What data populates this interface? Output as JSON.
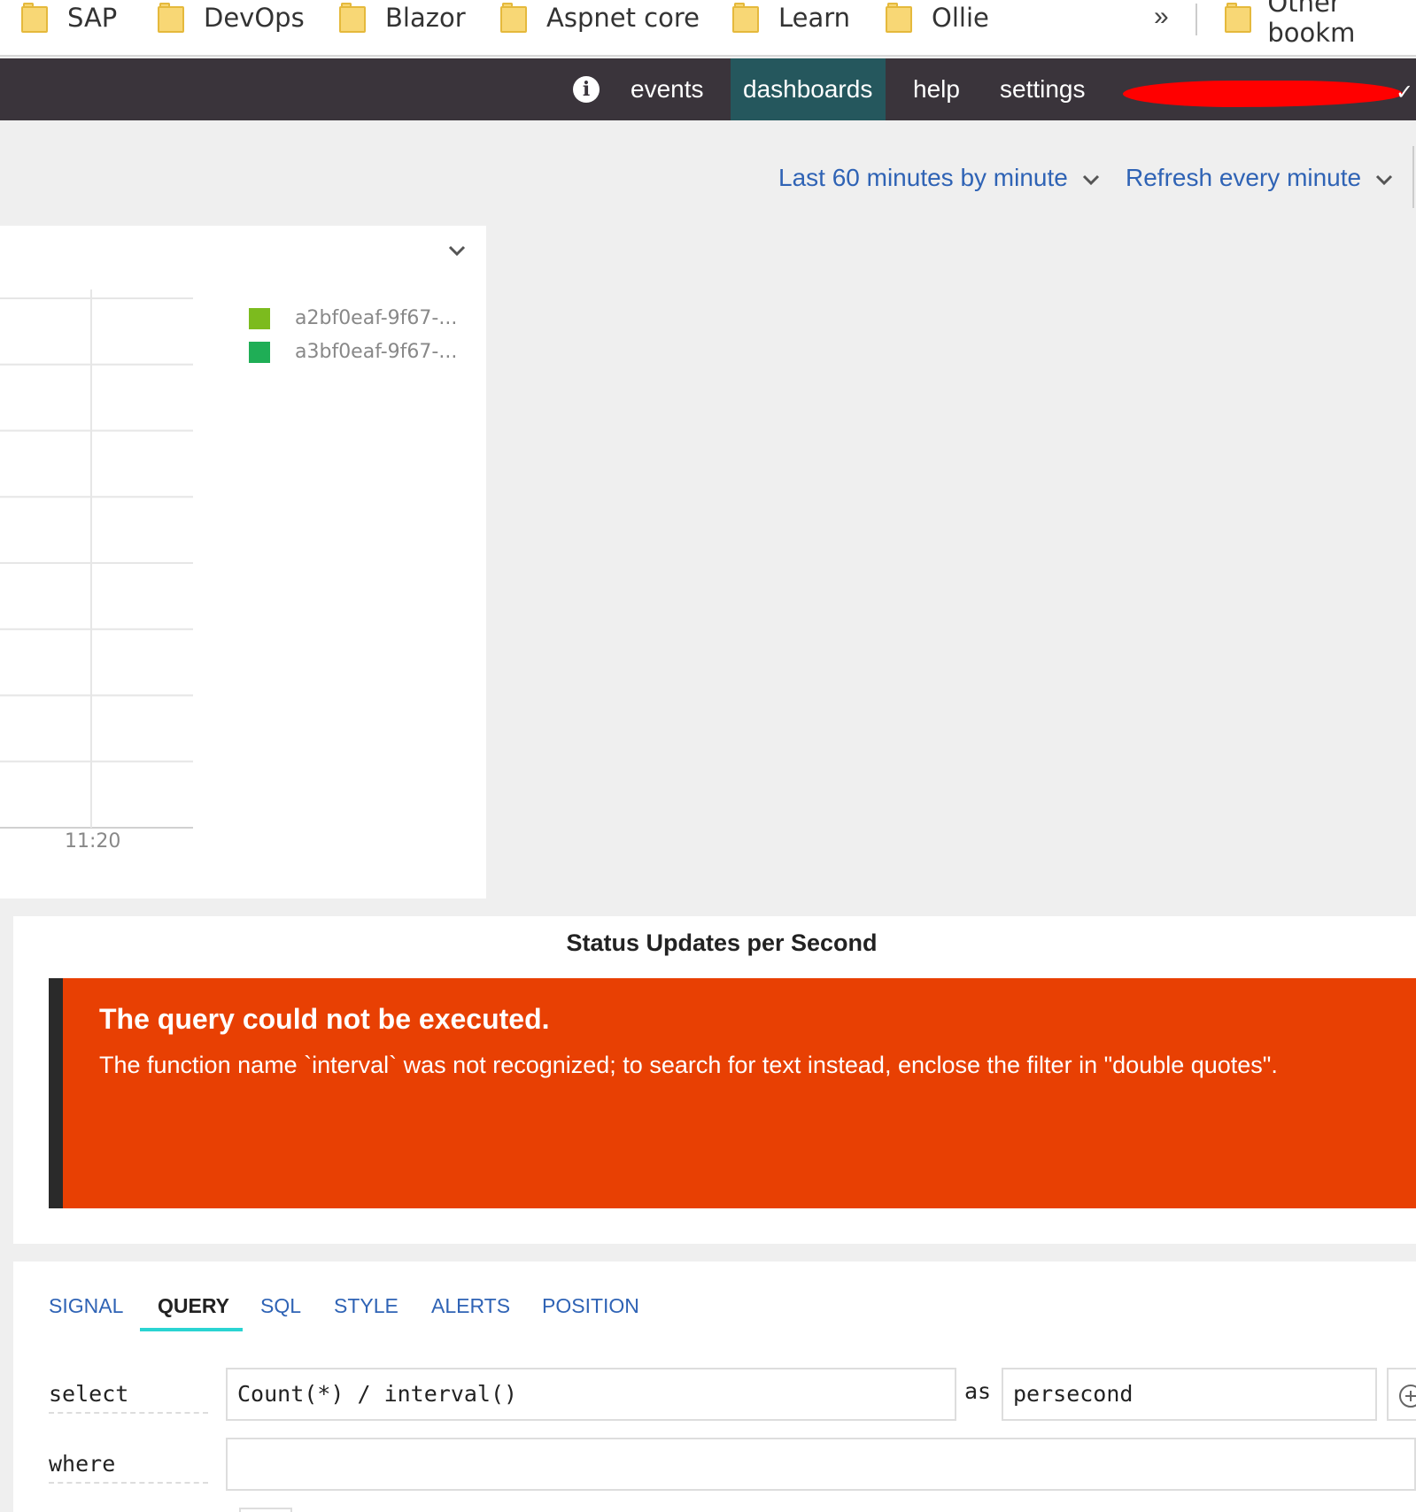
{
  "bookmarks": {
    "items": [
      {
        "label": "SAP"
      },
      {
        "label": "DevOps"
      },
      {
        "label": "Blazor"
      },
      {
        "label": "Aspnet core"
      },
      {
        "label": "Learn"
      },
      {
        "label": "Ollie"
      }
    ],
    "overflow_icon": "»",
    "other": "Other bookm"
  },
  "nav": {
    "info_icon": "i",
    "events": "events",
    "dashboards": "dashboards",
    "help": "help",
    "settings": "settings",
    "user_check": "✓",
    "active_color": "#25575d",
    "bar_color": "#3a343b"
  },
  "toolbar": {
    "time_range": "Last 60 minutes by minute",
    "refresh": "Refresh every minute",
    "link_color": "#2f63b5"
  },
  "chart_data": {
    "type": "line",
    "title": "",
    "xlabel": "",
    "ylabel": "",
    "x_ticks": [
      "11:20"
    ],
    "grid": true,
    "legend_position": "right",
    "series": [
      {
        "name": "a2bf0eaf-9f67-...",
        "color": "#7cbb1e",
        "values": []
      },
      {
        "name": "a3bf0eaf-9f67-...",
        "color": "#1fae56",
        "values": []
      }
    ]
  },
  "error_panel": {
    "title": "Status Updates per Second",
    "heading": "The query could not be executed.",
    "message": "The function name `interval` was not recognized; to search for text instead, enclose the filter in \"double quotes\".",
    "error_color": "#e84003"
  },
  "editor": {
    "tabs": [
      "SIGNAL",
      "QUERY",
      "SQL",
      "STYLE",
      "ALERTS",
      "POSITION"
    ],
    "active_tab": "QUERY",
    "select_label": "select",
    "select_value": "Count(*) / interval()",
    "as_label": "as",
    "alias_value": "persecond",
    "where_label": "where",
    "where_value": ""
  }
}
